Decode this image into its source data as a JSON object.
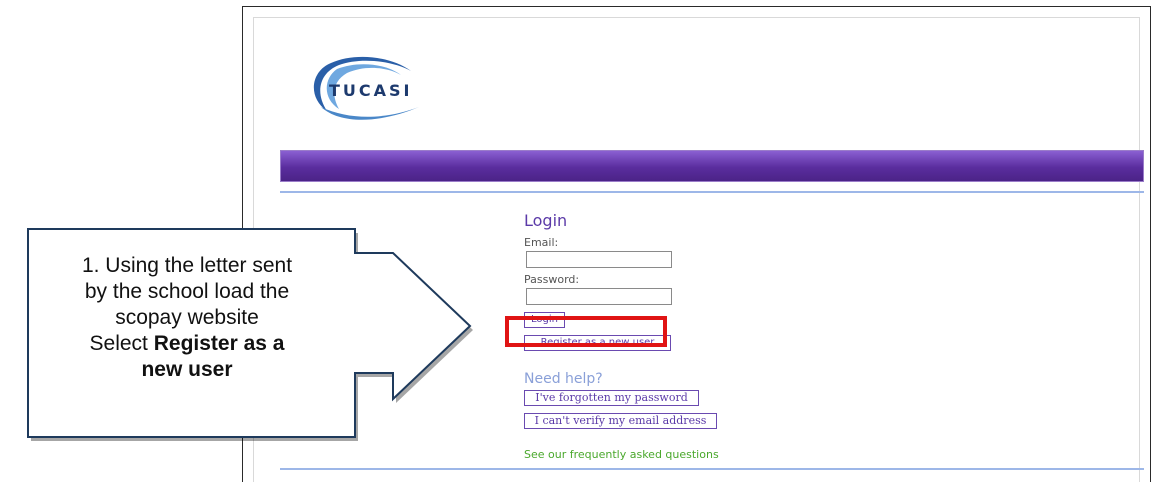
{
  "app": {
    "logo_text": "TUCASI"
  },
  "login": {
    "title": "Login",
    "email_label": "Email:",
    "email_value": "",
    "password_label": "Password:",
    "password_value": "",
    "login_button": "Login",
    "register_button": "Register as a new user"
  },
  "help": {
    "title": "Need help?",
    "forgot_password_button": "I've forgotten my password",
    "verify_email_button": "I can't verify my email address",
    "faq_link": "See our frequently asked questions"
  },
  "callout": {
    "line1": "1. Using the letter sent",
    "line2": "by the school load the",
    "line3": "scopay website",
    "line4_prefix": "Select ",
    "line4_bold": "Register as a",
    "line5_bold": "new user"
  },
  "colors": {
    "accent_purple": "#5b3aa8",
    "banner_purple": "#5a2d9e",
    "highlight_red": "#e01414",
    "faq_green": "#4aa82c",
    "callout_border": "#1e3a5c"
  },
  "icons": {
    "logo": "tucasi-swoosh-logo",
    "callout_arrow": "right-arrow-callout"
  }
}
